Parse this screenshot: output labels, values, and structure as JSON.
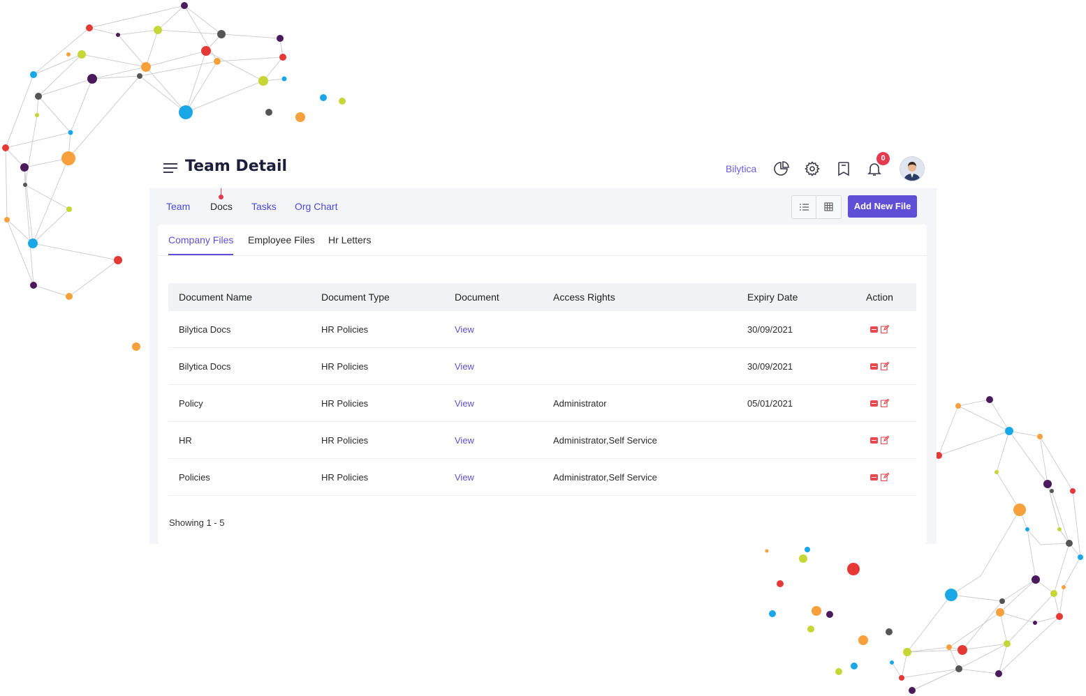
{
  "header": {
    "title": "Team Detail",
    "company": "Bilytica",
    "notification_count": "0",
    "icons": [
      "menu-icon",
      "pie-chart-icon",
      "gear-icon",
      "bookmark-icon",
      "bell-icon",
      "avatar"
    ]
  },
  "nav": {
    "tabs": [
      {
        "label": "Team",
        "active": false
      },
      {
        "label": "Docs",
        "active": true
      },
      {
        "label": "Tasks",
        "active": false
      },
      {
        "label": "Org Chart",
        "active": false
      }
    ],
    "view_toggle": [
      "list-view-icon",
      "grid-view-icon"
    ],
    "add_button": "Add New File"
  },
  "subtabs": [
    {
      "label": "Company Files",
      "active": true
    },
    {
      "label": "Employee Files",
      "active": false
    },
    {
      "label": "Hr Letters",
      "active": false
    }
  ],
  "table": {
    "columns": [
      "Document Name",
      "Document Type",
      "Document",
      "Access Rights",
      "Expiry Date",
      "Action"
    ],
    "rows": [
      {
        "name": "Bilytica Docs",
        "type": "HR Policies",
        "document": "View",
        "access": "",
        "expiry": "30/09/2021"
      },
      {
        "name": "Bilytica Docs",
        "type": "HR Policies",
        "document": "View",
        "access": "",
        "expiry": "30/09/2021"
      },
      {
        "name": "Policy",
        "type": "HR Policies",
        "document": "View",
        "access": "Administrator",
        "expiry": "05/01/2021"
      },
      {
        "name": "HR",
        "type": "HR Policies",
        "document": "View",
        "access": "Administrator,Self Service",
        "expiry": ""
      },
      {
        "name": "Policies",
        "type": "HR Policies",
        "document": "View",
        "access": "Administrator,Self Service",
        "expiry": ""
      }
    ]
  },
  "footer": {
    "showing": "Showing 1 - 5"
  },
  "colors": {
    "accent": "#5e4fd6",
    "link": "#4a4ad6",
    "danger": "#e5484d",
    "badge": "#e53950"
  }
}
